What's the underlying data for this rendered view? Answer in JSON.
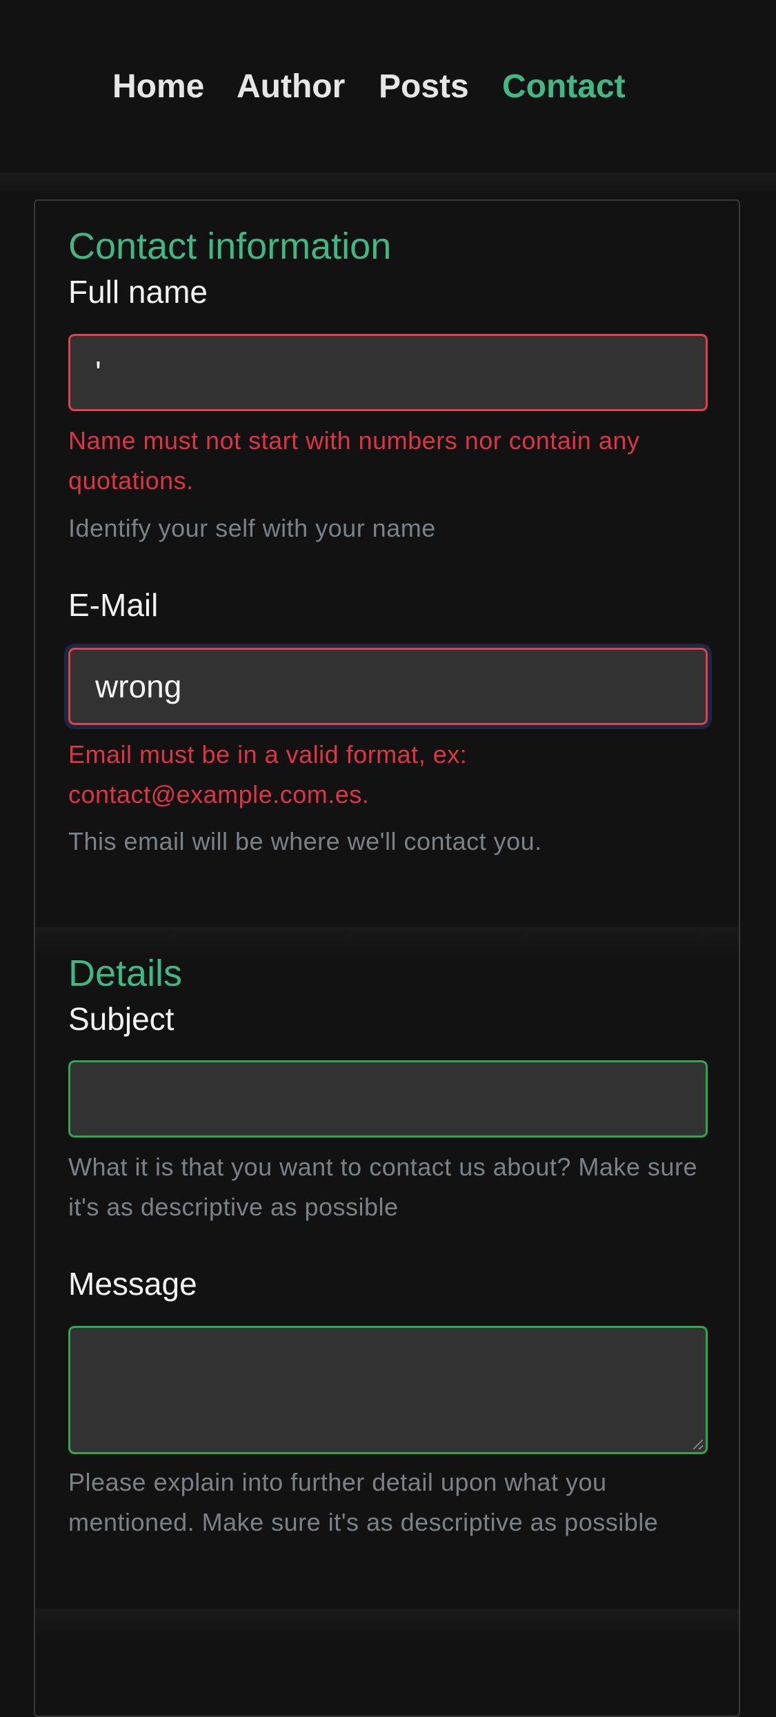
{
  "nav": {
    "items": [
      {
        "label": "Home",
        "active": false
      },
      {
        "label": "Author",
        "active": false
      },
      {
        "label": "Posts",
        "active": false
      },
      {
        "label": "Contact",
        "active": true
      }
    ]
  },
  "contact_section": {
    "title": "Contact information",
    "full_name": {
      "label": "Full name",
      "value": "'",
      "error": "Name must not start with numbers nor contain any quotations.",
      "help": "Identify your self with your name"
    },
    "email": {
      "label": "E-Mail",
      "value": "wrong",
      "error": "Email must be in a valid format, ex: contact@example.com.es.",
      "help": "This email will be where we'll contact you."
    }
  },
  "details_section": {
    "title": "Details",
    "subject": {
      "label": "Subject",
      "value": "",
      "help": "What it is that you want to contact us about? Make sure it's as descriptive as possible"
    },
    "message": {
      "label": "Message",
      "value": "",
      "help": "Please explain into further detail upon what you mentioned. Make sure it's as descriptive as possible"
    }
  },
  "colors": {
    "accent": "#41b883",
    "error": "#dc3545",
    "valid": "#2fa84f",
    "muted": "#7b8287",
    "background": "#121212",
    "input_background": "#323232"
  }
}
